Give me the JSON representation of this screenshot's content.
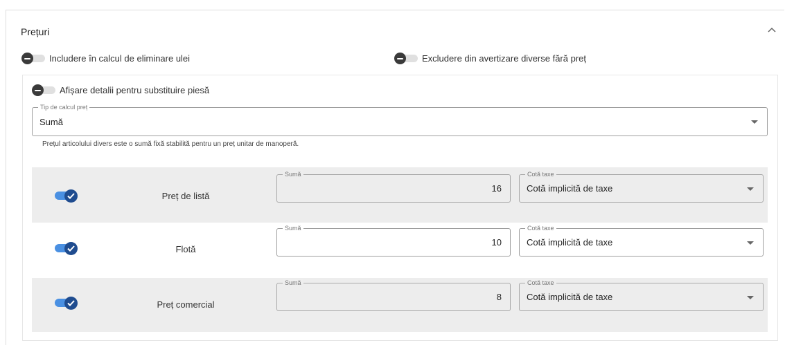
{
  "section": {
    "title": "Prețuri"
  },
  "toggles": {
    "oil_disposal": "Includere în calcul de eliminare ulei",
    "exclude_warning": "Excludere din avertizare diverse fără preț",
    "substitution_details": "Afișare detalii pentru substituire piesă"
  },
  "price_calc": {
    "label": "Tip de calcul preț",
    "value": "Sumă",
    "helper": "Prețul articolului divers este o sumă fixă stabilită pentru un preț unitar de manoperă."
  },
  "rows": [
    {
      "name": "Preț de listă",
      "enabled": true,
      "amount_label": "Sumă",
      "amount": "16",
      "tax_label": "Cotă taxe",
      "tax": "Cotă implicită de taxe",
      "disabled": true
    },
    {
      "name": "Flotă",
      "enabled": true,
      "amount_label": "Sumă",
      "amount": "10",
      "tax_label": "Cotă taxe",
      "tax": "Cotă implicită de taxe",
      "disabled": false
    },
    {
      "name": "Preț comercial",
      "enabled": true,
      "amount_label": "Sumă",
      "amount": "8",
      "tax_label": "Cotă taxe",
      "tax": "Cotă implicită de taxe",
      "disabled": true
    }
  ],
  "colors": {
    "toggle_on_track": "#4a90e2",
    "toggle_on_knob": "#1f4c8f",
    "disabled_bg": "#ededed"
  }
}
